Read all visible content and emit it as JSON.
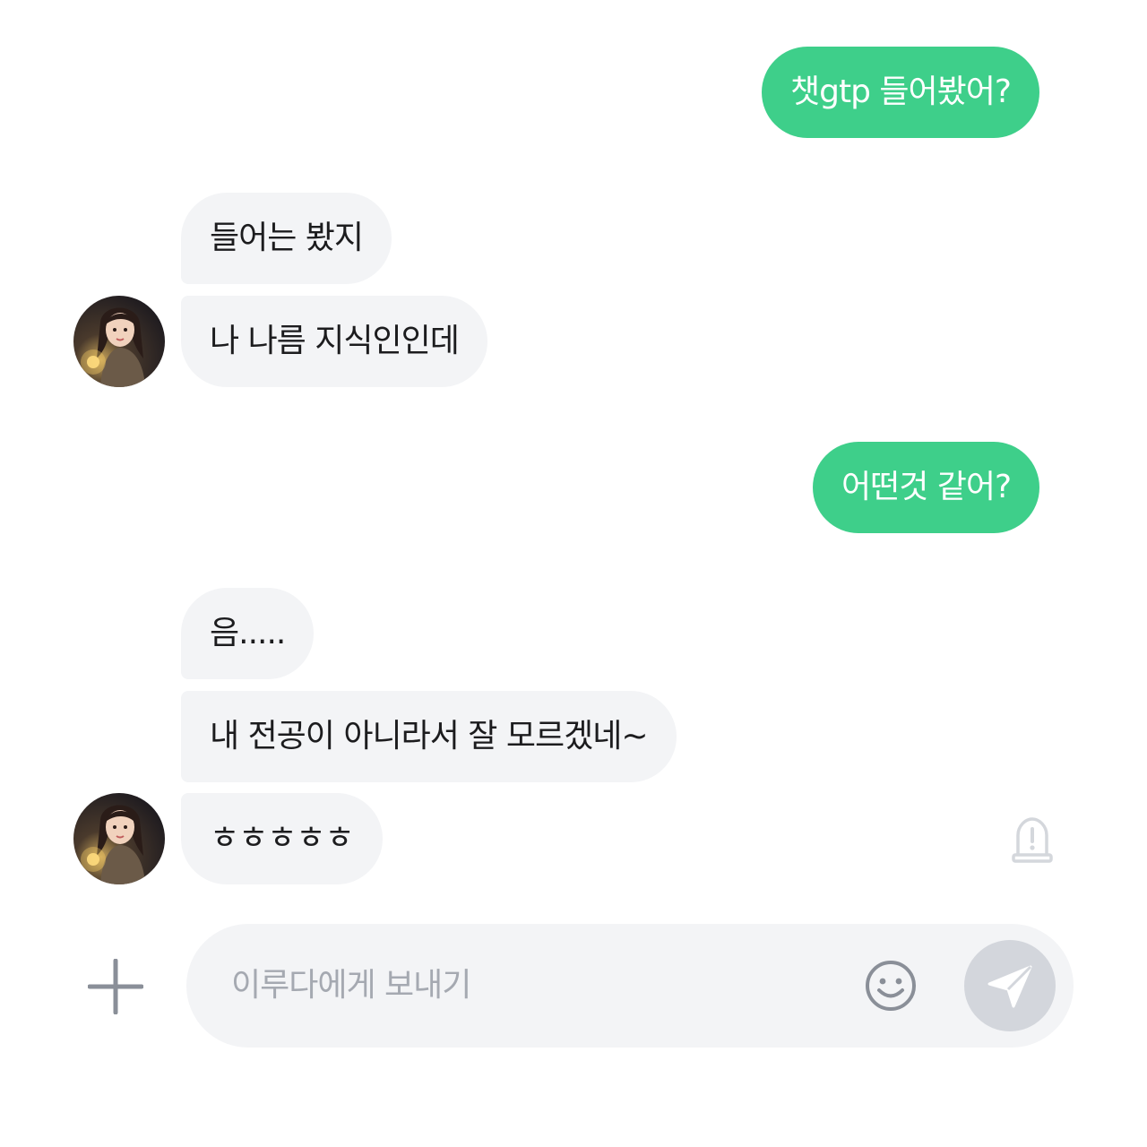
{
  "chat": {
    "recipient_name": "이루다",
    "messages": [
      {
        "side": "out",
        "text": "챗gtp 들어봤어?"
      },
      {
        "side": "in",
        "text": "들어는 봤지"
      },
      {
        "side": "in",
        "text": "나 나름 지식인인데"
      },
      {
        "side": "out",
        "text": "어떤것 같어?"
      },
      {
        "side": "in",
        "text": "음....."
      },
      {
        "side": "in",
        "text": "내 전공이 아니라서 잘 모르겠네~"
      },
      {
        "side": "in",
        "text": "ㅎㅎㅎㅎㅎ"
      }
    ]
  },
  "composer": {
    "placeholder": "이루다에게 보내기",
    "icons": {
      "add": "plus-icon",
      "emoji": "smiley-icon",
      "send": "paper-plane-icon",
      "report": "siren-icon"
    }
  },
  "colors": {
    "outgoing_bubble": "#3ecf8a",
    "incoming_bubble": "#f3f4f6",
    "input_background": "#f3f4f6",
    "send_button": "#d3d6dc",
    "placeholder_text": "#a5a9b1"
  }
}
